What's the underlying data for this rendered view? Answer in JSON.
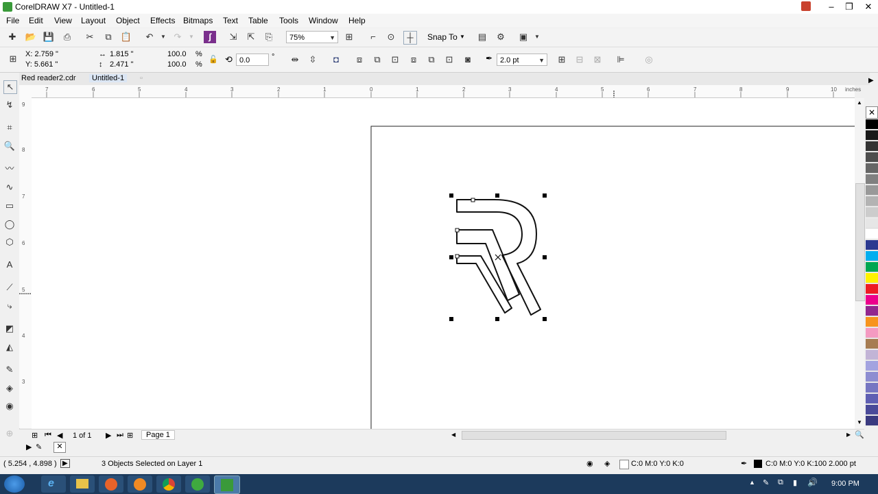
{
  "app": {
    "title": "CorelDRAW X7 - Untitled-1",
    "window_buttons": {
      "minimize": "–",
      "restore": "❐",
      "close": "✕"
    }
  },
  "menu": [
    "File",
    "Edit",
    "View",
    "Layout",
    "Object",
    "Effects",
    "Bitmaps",
    "Text",
    "Table",
    "Tools",
    "Window",
    "Help"
  ],
  "standard_toolbar": {
    "zoom_level": "75%",
    "snap_to": "Snap To"
  },
  "property_bar": {
    "x": "X: 2.759 \"",
    "y": "Y: 5.661 \"",
    "width": "1.815 \"",
    "height": "2.471 \"",
    "scale_x": "100.0",
    "scale_y": "100.0",
    "percent": "%",
    "rotation": "0.0",
    "degree": "°",
    "outline_width": "2.0 pt"
  },
  "doc_tabs": [
    "Red reader2.cdr",
    "Untitled-1"
  ],
  "ruler": {
    "units": "inches",
    "h_ticks": [
      "7",
      "6",
      "5",
      "4",
      "3",
      "2",
      "1",
      "0",
      "1",
      "2",
      "3",
      "4",
      "5",
      "6",
      "7",
      "8",
      "9",
      "10"
    ],
    "v_ticks": [
      "9",
      "8",
      "7",
      "6",
      "5",
      "4",
      "3"
    ]
  },
  "page_nav": {
    "page_count": "1 of 1",
    "page_tab": "Page 1"
  },
  "status": {
    "cursor_pos": "( 5.254 , 4.898 )",
    "selection": "3 Objects Selected on Layer 1",
    "fill": "C:0 M:0 Y:0 K:0",
    "outline": "C:0 M:0 Y:0 K:100  2.000 pt"
  },
  "taskbar": {
    "time": "9:00 PM"
  },
  "palette_colors": [
    "#000000",
    "#1a1a1a",
    "#333333",
    "#4d4d4d",
    "#666666",
    "#808080",
    "#999999",
    "#b3b3b3",
    "#cccccc",
    "#e6e6e6",
    "#ffffff",
    "#2b3990",
    "#00aeef",
    "#00a651",
    "#fff200",
    "#ed1c24",
    "#ec008c",
    "#92278f",
    "#f7941d",
    "#f49ac1",
    "#a67c52",
    "#c2b4d6",
    "#a3a3e0",
    "#8d8dd1",
    "#7676c2",
    "#5f5fb3",
    "#4a4a99",
    "#3a3a80"
  ],
  "colors": {
    "taskbar": "#1c3a5c",
    "chrome": "#f0f0f0",
    "accent_green": "#3a9a3a"
  }
}
